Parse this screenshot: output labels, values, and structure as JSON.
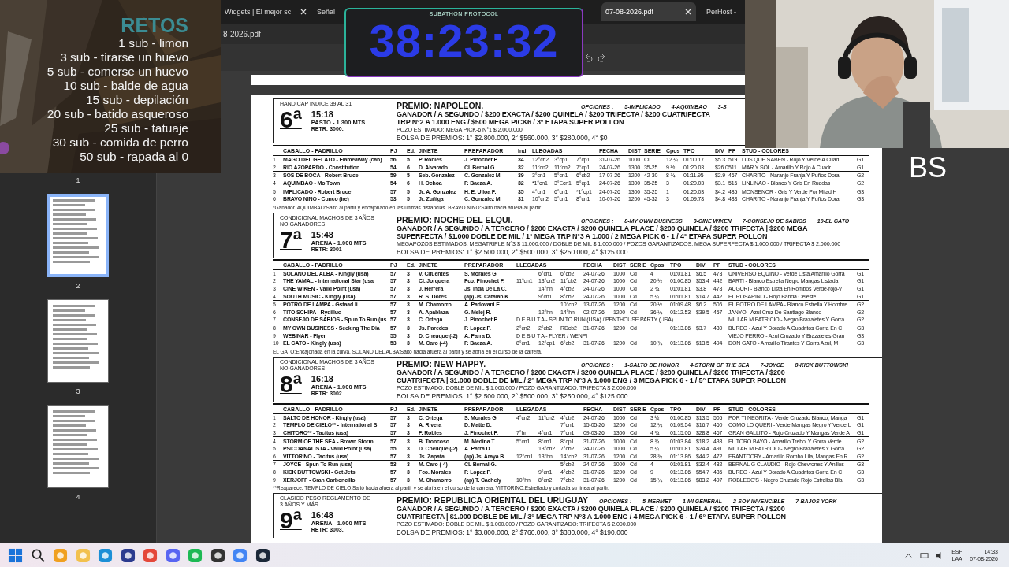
{
  "overlay": {
    "retos_title": "RETOS",
    "retos": [
      "1 sub - limon",
      "3 sub - tirarse un huevo",
      "5 sub - comerse un huevo",
      "10 sub - balde de agua",
      "15 sub - depilación",
      "20 sub - batido asqueroso",
      "25 sub - tatuaje",
      "30 sub - comida de perro",
      "50 sub - rapada al 0"
    ],
    "timer": {
      "label": "SUBATHON PROTOCOL",
      "time": "38:23:32"
    },
    "corner_text": "BS"
  },
  "browser": {
    "tabs": [
      {
        "label": "Widgets | El mejor sc",
        "selected": false
      },
      {
        "label": "Señal",
        "selected": false
      },
      {
        "label": "07-08-2026.pdf",
        "selected": true
      },
      {
        "label": "PerHost -",
        "selected": false
      }
    ],
    "address": "8-2026.pdf"
  },
  "first_page_label": "1",
  "thumbnails": [
    {
      "label": "2",
      "selected": true
    },
    {
      "label": "3",
      "selected": false
    },
    {
      "label": "4",
      "selected": false
    }
  ],
  "races": [
    {
      "condition": "HANDICAP INDICE 39 AL 31",
      "number": "6ª",
      "time": "15:18",
      "track": "PASTO - 1.300 MTS",
      "retr": "RETR: 3000.",
      "prize": "PREMIO: NAPOLEON.",
      "options_label": "OPCIONES :",
      "options": [
        "5-IMPLICADO",
        "4-AQUIMBAO",
        "3-S"
      ],
      "bets": [
        "GANADOR / A SEGUNDO / $200 EXACTA / $200 QUINELA / $200 TRIFECTA / $200 CUATRIFECTA",
        "TRP N°2 A 1.000 ENG / $500 MEGA PICK6 / 3° ETAPA SUPER POLLON"
      ],
      "pool": "POZO ESTIMADO: MEGA PICK-6 N°1 $ 2.000.000",
      "purse": "BOLSA DE PREMIOS: 1° $2.800.000, 2° $560.000, 3° $280.000, 4° $0",
      "columns": [
        "CABALLO - PADRILLO",
        "PJ",
        "Ed.",
        "JINETE",
        "PREPARADOR",
        "Ind",
        "LLEGADAS",
        "FECHA",
        "DIST",
        "SERIE",
        "Cpos",
        "TPO",
        "DIV",
        "PF",
        "STUD - COLORES"
      ],
      "rows": [
        {
          "n": "1",
          "horse": "MAGO DEL GELATO - Flameaway (can)",
          "pj": "56",
          "ed": "5",
          "jockey": "P. Robles",
          "trainer": "J. Pinochet P.",
          "ind": "34",
          "lleg": [
            "12°cn2",
            "3°cp1",
            "7°cp1"
          ],
          "fecha": "31-07-26",
          "dist": "1000",
          "serie": "Cl",
          "cpos": "12 ¼",
          "tpo": "01:00.17",
          "div": "$5.3",
          "pf": "519",
          "stud": "LOS QUE SABEN - Rojo Y Verde A Cuad",
          "grp": "G1"
        },
        {
          "n": "2",
          "horse": "RIO AZOPARDO - Constitution",
          "pj": "54",
          "ed": "6",
          "jockey": "D. Alvarado",
          "trainer": "Cl. Bernal G.",
          "ind": "32",
          "lleg": [
            "11°cn2",
            "11°cn2",
            "7°cp1"
          ],
          "fecha": "24-07-26",
          "dist": "1300",
          "serie": "35-25",
          "cpos": "9 ½",
          "tpo": "01:20.03",
          "div": "$26.0",
          "pf": "511",
          "stud": "MAR Y SOL - Amarillo Y Rojo A Cuadr",
          "grp": "G1"
        },
        {
          "n": "3",
          "horse": "SOS DE BOCA - Robert Bruce",
          "pj": "59",
          "ed": "5",
          "jockey": "Seb. Gonzalez",
          "trainer": "C. Gonzalez M.",
          "ind": "39",
          "lleg": [
            "3°cn1",
            "5°cn1",
            "6°cb2"
          ],
          "fecha": "17-07-26",
          "dist": "1200",
          "serie": "42-30",
          "cpos": "8 ¾",
          "tpo": "01:11.95",
          "div": "$2.9",
          "pf": "467",
          "stud": "CHARITO - Naranjo Franja Y Puños Dora",
          "grp": "G2"
        },
        {
          "n": "4",
          "horse": "AQUIMBAO - Mo Town",
          "pj": "54",
          "ed": "6",
          "jockey": "H. Ochoa",
          "trainer": "P. Baeza A.",
          "ind": "32",
          "lleg": [
            "*1°cn1",
            "3°Ecn1",
            "5°cp1"
          ],
          "fecha": "24-07-26",
          "dist": "1300",
          "serie": "35-25",
          "cpos": "3",
          "tpo": "01:20.03",
          "div": "$3.1",
          "pf": "516",
          "stud": "LINLINAO - Blanco Y Gris En Ruedas",
          "grp": "G2"
        },
        {
          "n": "5",
          "horse": "IMPLICADO - Robert Bruce",
          "pj": "57",
          "ed": "5",
          "jockey": "Jr. A. Gonzalez",
          "trainer": "H. E. Ulloa P.",
          "ind": "35",
          "lleg": [
            "4°cn1",
            "6°cn1",
            "*1°cp1"
          ],
          "fecha": "24-07-26",
          "dist": "1300",
          "serie": "35-25",
          "cpos": "1",
          "tpo": "01:20.03",
          "div": "$4.2",
          "pf": "485",
          "stud": "MONSENOR - Gris Y Verde Por Mitad H",
          "grp": "G3"
        },
        {
          "n": "6",
          "horse": "BRAVO NINO - Cunco (ire)",
          "pj": "53",
          "ed": "5",
          "jockey": "Jr. Zuñiga",
          "trainer": "C. Gonzalez M.",
          "ind": "31",
          "lleg": [
            "10°cn2",
            "5°cn1",
            "8°cn1"
          ],
          "fecha": "10-07-26",
          "dist": "1200",
          "serie": "45-32",
          "cpos": "3",
          "tpo": "01:09.78",
          "div": "$4.8",
          "pf": "488",
          "stud": "CHARITO - Naranjo Franja Y Puños Dora",
          "grp": "G3"
        }
      ],
      "note": "*Ganador. AQUIMBAO:Saltó al partir y encajonado en las últimas distancias. BRAVO NINO:Saltó hacia afuera al partir."
    },
    {
      "condition": "CONDICIONAL MACHOS DE 3 AÑOS NO GANADORES",
      "number": "7ª",
      "time": "15:48",
      "track": "ARENA - 1.000 MTS",
      "retr": "RETR: 3001",
      "prize": "PREMIO: NOCHE DEL ELQUI.",
      "options_label": "OPCIONES :",
      "options": [
        "8-MY OWN BUSINESS",
        "3-CINE WIKEN",
        "7-CONSEJO DE SABIOS",
        "10-EL GATO"
      ],
      "bets": [
        "GANADOR / A SEGUNDO / A TERCERO / $200 EXACTA / $200 QUINELA PLACE / $200 QUINELA / $200 TRIFECTA | $200 MEGA",
        "SUPERFECTA / $1.000 DOBLE DE MIL / 1° MEGA TRP N°3 A 1.000 / 2 MEGA PICK 6 - 1 / 4° ETAPA SUPER POLLON"
      ],
      "pool": "MEGAPOZOS ESTIMADOS: MEGATRIPLE N°3 $ 11.000.000 / DOBLE DE MIL $ 1.000.000 / POZOS GARANTIZADOS: MEGA SUPERFECTA $ 1.000.000 / TRIFECTA $ 2.000.000",
      "purse": "BOLSA DE PREMIOS: 1° $2.500.000, 2° $500.000, 3° $250.000, 4° $125.000",
      "columns": [
        "CABALLO - PADRILLO",
        "PJ",
        "Ed.",
        "JINETE",
        "PREPARADOR",
        "LLEGADAS",
        "FECHA",
        "DIST",
        "SERIE",
        "Cpos",
        "TPO",
        "DIV",
        "PF",
        "STUD - COLORES"
      ],
      "rows": [
        {
          "n": "1",
          "horse": "SOLANO DEL ALBA - Kingly (usa)",
          "pj": "57",
          "ed": "3",
          "jockey": "V. Cifuentes",
          "trainer": "S. Morales G.",
          "lleg": [
            "6°cn1",
            "6°cb2"
          ],
          "fecha": "24-07-26",
          "dist": "1000",
          "serie": "Cd",
          "cpos": "4",
          "tpo": "01:01.81",
          "div": "$6.5",
          "pf": "473",
          "stud": "UNIVERSO EQUINO - Verde Lista Amarillo Gorra",
          "grp": "G1"
        },
        {
          "n": "2",
          "horse": "THE YAMAL - International Star (usa",
          "pj": "57",
          "ed": "3",
          "jockey": "Cl. Jorquera",
          "trainer": "Fco. Pinochet P.",
          "lleg": [
            "11°cn1",
            "13°cn2",
            "11°cb2"
          ],
          "fecha": "24-07-26",
          "dist": "1000",
          "serie": "Cd",
          "cpos": "20 ½",
          "tpo": "01:00.85",
          "div": "$53.4",
          "pf": "442",
          "stud": "BARTI - Blanco Estrella Negro Mangas Listada",
          "grp": "G1"
        },
        {
          "n": "3",
          "horse": "CINE WIKEN - Valid Point (usa)",
          "pj": "57",
          "ed": "3",
          "jockey": "J. Herrera",
          "trainer": "Js. Inda De La C.",
          "lleg": [
            "14°hn",
            "4°cb2"
          ],
          "fecha": "24-07-26",
          "dist": "1000",
          "serie": "Cd",
          "cpos": "2 ¾",
          "tpo": "01:01.81",
          "div": "$3.8",
          "pf": "478",
          "stud": "AUGURI - Blanco Lista En Rombos Verde-rojo-v",
          "grp": "G1"
        },
        {
          "n": "4",
          "horse": "SOUTH MUSIC - Kingly (usa)",
          "pj": "57",
          "ed": "3",
          "jockey": "R. S. Dores",
          "trainer": "(ap) Js. Catalan K.",
          "lleg": [
            "9°cn1",
            "8°cb2"
          ],
          "fecha": "24-07-26",
          "dist": "1000",
          "serie": "Cd",
          "cpos": "5 ¼",
          "tpo": "01:01.81",
          "div": "$14.7",
          "pf": "442",
          "stud": "EL ROSARINO - Rojo Banda Celeste.",
          "grp": "G1"
        },
        {
          "n": "5",
          "horse": "POTRO DE LAMPA - Gstaad Ii",
          "pj": "57",
          "ed": "3",
          "jockey": "M. Chamorro",
          "trainer": "A. Padovani E.",
          "lleg": [
            "10°cn2"
          ],
          "fecha": "13-07-26",
          "dist": "1200",
          "serie": "Cd",
          "cpos": "20 ½",
          "tpo": "01:09.48",
          "div": "$6.2",
          "pf": "506",
          "stud": "EL POTRO DE LAMPA - Blanco Estrella Y Hombre",
          "grp": "G2"
        },
        {
          "n": "6",
          "horse": "TITO SCHIPA - Rydilluc",
          "pj": "57",
          "ed": "3",
          "jockey": "A. Apablaza",
          "trainer": "G. Melej R.",
          "lleg": [
            "12°hn",
            "14°hn"
          ],
          "fecha": "02-07-26",
          "dist": "1200",
          "serie": "Cd",
          "cpos": "36 ¼",
          "tpo": "01:12.53",
          "div": "$39.5",
          "pf": "457",
          "stud": "JANYO - Azul Cruz De Santiago Blanco",
          "grp": "G2"
        },
        {
          "n": "7",
          "horse": "CONSEJO DE SABIOS - Spun To Run (us",
          "pj": "57",
          "ed": "3",
          "jockey": "C. Ortega",
          "trainer": "J. Pinochet P.",
          "debut": "D E B U T A - SPUN TO RUN (USA) / PENTHOUSE PARTY (USA)",
          "stud": "MILLAR M PATRICIO - Negro Brazaletes Y Gorra",
          "grp": "G2"
        },
        {
          "n": "8",
          "horse": "MY OWN BUSINESS - Seeking The Dia",
          "pj": "57",
          "ed": "3",
          "jockey": "Js. Paredes",
          "trainer": "P. Lopez P.",
          "lleg": [
            "2°cn2",
            "2°cb2",
            "RDcb2"
          ],
          "fecha": "31-07-26",
          "dist": "1200",
          "serie": "Cd",
          "tpo": "01:13.86",
          "div": "$3.7",
          "pf": "430",
          "stud": "BUREO - Azul Y Dorado A Cuadritos Gorra En C",
          "grp": "G3"
        },
        {
          "n": "9",
          "horse": "WEBINAR - Flyer",
          "pj": "55",
          "ed": "3",
          "jockey": "D. Cheuque (-2)",
          "trainer": "A. Parra D.",
          "debut": "D E B U T A - FLYER / WENPI",
          "stud": "VIEJO PERRO - Azul Cruzado Y Brazaletes Gran",
          "grp": "G3"
        },
        {
          "n": "10",
          "horse": "EL GATO - Kingly (usa)",
          "pj": "53",
          "ed": "3",
          "jockey": "M. Caro (-4)",
          "trainer": "P. Baeza A.",
          "lleg": [
            "8°cn1",
            "12°cp1",
            "6°cb2"
          ],
          "fecha": "31-07-26",
          "dist": "1200",
          "serie": "Cd",
          "cpos": "10 ¾",
          "tpo": "01:13.86",
          "div": "$13.5",
          "pf": "494",
          "stud": "DON GATO - Amarillo Tirantes Y Gorra Azul, M",
          "grp": "G3"
        }
      ],
      "note": "EL GATO:Encajonada en la curva. SOLANO DEL ALBA:Saltó hacia afuera al partir y se abría en el curso de la carrera."
    },
    {
      "condition": "CONDICIONAL MACHOS DE 3 AÑOS NO GANADORES",
      "number": "8ª",
      "time": "16:18",
      "track": "ARENA - 1.000 MTS",
      "retr": "RETR: 3002.",
      "prize": "PREMIO: NEW HAPPY.",
      "options_label": "OPCIONES :",
      "options": [
        "1-SALTO DE HONOR",
        "4-STORM OF THE SEA",
        "7-JOYCE",
        "8-KICK BUTTOWSKI"
      ],
      "bets": [
        "GANADOR / A SEGUNDO / A TERCERO / $200 EXACTA / $200 QUINELA PLACE / $200 QUINELA / $200 TRIFECTA / $200",
        "CUATRIFECTA | $1.000 DOBLE DE MIL / 2° MEGA TRP N°3 A 1.000 ENG / 3 MEGA PICK 6 - 1 / 5° ETAPA SUPER POLLON"
      ],
      "pool": "POZO ESTIMADO: DOBLE DE MIL $ 1.000.000 / POZO GARANTIZADO: TRIFECTA $ 2.000.000",
      "purse": "BOLSA DE PREMIOS: 1° $2.500.000, 2° $500.000, 3° $250.000, 4° $125.000",
      "columns": [
        "CABALLO - PADRILLO",
        "PJ",
        "Ed.",
        "JINETE",
        "PREPARADOR",
        "LLEGADAS",
        "FECHA",
        "DIST",
        "SERIE",
        "Cpos",
        "TPO",
        "DIV",
        "PF",
        "STUD - COLORES"
      ],
      "rows": [
        {
          "n": "1",
          "horse": "SALTO DE HONOR - Kingly (usa)",
          "pj": "57",
          "ed": "3",
          "jockey": "C. Ortega",
          "trainer": "S. Morales G.",
          "lleg": [
            "4°cn2",
            "11°cn2",
            "4°cb2"
          ],
          "fecha": "24-07-26",
          "dist": "1000",
          "serie": "Cd",
          "cpos": "3 ½",
          "tpo": "01:00.85",
          "div": "$13.5",
          "pf": "505",
          "stud": "POR TI NEGRITA - Verde Cruzado Blanco, Manga",
          "grp": "G1"
        },
        {
          "n": "2",
          "horse": "TEMPLO DE CIELO** - International S",
          "pj": "57",
          "ed": "3",
          "jockey": "A. Rivera",
          "trainer": "D. Matte D.",
          "lleg": [
            "7°cn1"
          ],
          "fecha": "15-05-26",
          "dist": "1200",
          "serie": "Cd",
          "cpos": "12 ¼",
          "tpo": "01:09.54",
          "div": "$16.7",
          "pf": "460",
          "stud": "COMO LO QUERI - Verde Mangas Negro Y Verde L",
          "grp": "G1"
        },
        {
          "n": "3",
          "horse": "CHITORO** - Tacitus (usa)",
          "pj": "57",
          "ed": "3",
          "jockey": "P. Robles",
          "trainer": "J. Pinochet P.",
          "lleg": [
            "7°hn",
            "4°cn1",
            "7°cn1"
          ],
          "fecha": "09-03-26",
          "dist": "1300",
          "serie": "Cd",
          "cpos": "4 ¾",
          "tpo": "01:15.06",
          "div": "$28.8",
          "pf": "467",
          "stud": "GRAN GALLITO - Rojo Cruzado Y Mangas Verde A",
          "grp": "G1"
        },
        {
          "n": "4",
          "horse": "STORM OF THE SEA - Brown Storm",
          "pj": "57",
          "ed": "3",
          "jockey": "B. Troncoso",
          "trainer": "M. Medina T.",
          "lleg": [
            "5°cn1",
            "8°cn1",
            "8°cp1"
          ],
          "fecha": "31-07-26",
          "dist": "1000",
          "serie": "Cd",
          "cpos": "8 ¾",
          "tpo": "01:03.84",
          "div": "$18.2",
          "pf": "433",
          "stud": "EL TORO BAYO - Amarillo Trebol Y Gorra Verde",
          "grp": "G2"
        },
        {
          "n": "5",
          "horse": "PSICOANALISTA - Valid Point (usa)",
          "pj": "55",
          "ed": "3",
          "jockey": "D. Cheuque (-2)",
          "trainer": "A. Parra D.",
          "lleg": [
            "13°cn2",
            "7°cb2"
          ],
          "fecha": "24-07-26",
          "dist": "1000",
          "serie": "Cd",
          "cpos": "5 ¼",
          "tpo": "01:01.81",
          "div": "$24.4",
          "pf": "491",
          "stud": "MILLAR M PATRICIO - Negro Brazaletes Y Gorra",
          "grp": "G2"
        },
        {
          "n": "6",
          "horse": "VITTORINO - Tacitus (usa)",
          "pj": "57",
          "ed": "3",
          "jockey": "Js. Zapata",
          "trainer": "(ap) Js. Araya B.",
          "lleg": [
            "12°cn1",
            "13°hn",
            "14°cb2"
          ],
          "fecha": "31-07-26",
          "dist": "1200",
          "serie": "Cd",
          "cpos": "28 ¾",
          "tpo": "01:13.86",
          "div": "$44.2",
          "pf": "472",
          "stud": "FRANTOCRY - Amarillo Rombo Lila, Mangas En R",
          "grp": "G2"
        },
        {
          "n": "7",
          "horse": "JOYCE - Spun To Run (usa)",
          "pj": "53",
          "ed": "3",
          "jockey": "M. Caro (-4)",
          "trainer": "CL Bernal G.",
          "lleg": [
            "5°cb2"
          ],
          "fecha": "24-07-26",
          "dist": "1000",
          "serie": "Cd",
          "cpos": "4",
          "tpo": "01:01.81",
          "div": "$32.4",
          "pf": "482",
          "stud": "BERNAL G CLAUDIO - Rojo Chevrones Y Anillos",
          "grp": "G3"
        },
        {
          "n": "8",
          "horse": "KICK BUTTOWSKI - Get Jets",
          "pj": "57",
          "ed": "3",
          "jockey": "Fco. Morales",
          "trainer": "P. Lopez P.",
          "lleg": [
            "9°cn1",
            "4°cb2"
          ],
          "fecha": "31-07-26",
          "dist": "1200",
          "serie": "Cd",
          "cpos": "9",
          "tpo": "01:13.86",
          "div": "$54.7",
          "pf": "435",
          "stud": "BUREO - Azul Y Dorado A Cuadritos Gorra En C",
          "grp": "G3"
        },
        {
          "n": "9",
          "horse": "XERJOFF - Gran Carboncillo",
          "pj": "57",
          "ed": "3",
          "jockey": "M. Chamorro",
          "trainer": "(ap) T. Cachely",
          "lleg": [
            "10°hn",
            "8°cn2",
            "7°cb2"
          ],
          "fecha": "31-07-26",
          "dist": "1200",
          "serie": "Cd",
          "cpos": "15 ¼",
          "tpo": "01:13.86",
          "div": "$83.2",
          "pf": "497",
          "stud": "ROBLEDO'S - Negro Cruzado Rojo Estrellas Bla",
          "grp": "G3"
        }
      ],
      "note": "**Reaparece. TEMPLO DE CIELO:Saltó hacia afuera al partir y se abría en el curso de la carrera. VITTORINO:Estrellado y cortada su línea al partir."
    },
    {
      "condition": "CLÁSICO PESO REGLAMENTO DE 3 AÑOS Y MÁS",
      "number": "9ª",
      "time": "16:48",
      "track": "ARENA - 1.000 MTS",
      "retr": "RETR: 3003.",
      "prize": "PREMIO: REPUBLICA ORIENTAL DEL URUGUAY",
      "options_label": "OPCIONES :",
      "options": [
        "5-MERMET",
        "1-MI GENERAL",
        "2-SOY INVENCIBLE",
        "7-BAJOS YORK"
      ],
      "bets": [
        "GANADOR / A SEGUNDO / A TERCERO / $200 EXACTA / $200 QUINELA PLACE / $200 QUINELA / $200 TRIFECTA / $200",
        "CUATRIFECTA | $1.000 DOBLE DE MIL / 3° MEGA TRP N°3 A 1.000 ENG / 4 MEGA PICK 6 - 1 / 6° ETAPA SUPER POLLON"
      ],
      "pool": "POZO ESTIMADO: DOBLE DE MIL $ 1.000.000 / POZO GARANTIZADO: TRIFECTA $ 2.000.000",
      "purse": "BOLSA DE PREMIOS: 1° $3.800.000, 2° $760.000, 3° $380.000, 4° $190.000"
    }
  ],
  "taskbar": {
    "language": "ESP",
    "layout": "LAA",
    "time": "14:33",
    "date": "07-08-2026"
  }
}
